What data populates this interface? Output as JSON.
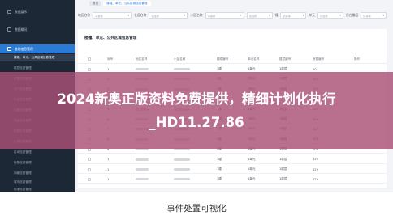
{
  "tabs": [
    {
      "label": "首页",
      "active": false
    },
    {
      "label": "楼幢、单元、公共区域信息管理",
      "active": true
    }
  ],
  "sidebar": {
    "items": [
      {
        "label": "数据展示",
        "active": false
      },
      {
        "label": "数据概况",
        "active": false
      },
      {
        "label": "基础信息管理",
        "active": true
      }
    ],
    "subitems": [
      {
        "label": "楼幢、单元、公共区域信息管理",
        "active": true
      },
      {
        "label": "楼层信息管理",
        "active": false
      },
      {
        "label": "房屋信息管理",
        "active": false
      },
      {
        "label": "住户信息管理",
        "active": false
      },
      {
        "label": "车位信息管理",
        "active": false
      },
      {
        "label": "设备信息管理",
        "active": false
      },
      {
        "label": "商铺信息管理",
        "active": false
      },
      {
        "label": "物业信息管理",
        "active": false
      },
      {
        "label": "小区信息管理",
        "active": false
      },
      {
        "label": "区域信息管理",
        "active": false
      },
      {
        "label": "标签信息管理",
        "active": false
      },
      {
        "label": "网格信息管理",
        "active": false
      },
      {
        "label": "城市信息管理",
        "active": false
      },
      {
        "label": "街道信息管理",
        "active": false
      }
    ]
  },
  "filters": [
    {
      "label": "地区名称",
      "placeholder": "请选择"
    },
    {
      "label": "社区名称",
      "placeholder": "请选择"
    },
    {
      "label": "小区名称",
      "placeholder": "请选择"
    },
    {
      "label": "幢",
      "placeholder": "请选择"
    },
    {
      "label": "单元",
      "placeholder": "请选择"
    },
    {
      "label": "所在楼层",
      "placeholder": "请选择"
    }
  ],
  "panel": {
    "title": "楼幢、单元、公共区域信息管理"
  },
  "table": {
    "headers": [
      "",
      "序号",
      "地区名称",
      "小区名称",
      "楼幢编号",
      "单元名称",
      "楼层编号",
      "房屋编号",
      "操作"
    ],
    "rows": [
      {
        "index": "1",
        "building": "1幢",
        "unit": "1单元",
        "floor": "1楼层",
        "room": "101"
      },
      {
        "index": "2",
        "building": "1幢",
        "unit": "1单元",
        "floor": "1楼层",
        "room": "102"
      },
      {
        "index": "3",
        "building": "1幢",
        "unit": "1单元",
        "floor": "1楼层",
        "room": "103"
      },
      {
        "index": "4",
        "building": "1幢",
        "unit": "1单元",
        "floor": "1楼层",
        "room": "104"
      },
      {
        "index": "5",
        "building": "1幢",
        "unit": "1单元",
        "floor": "1楼层",
        "room": "105"
      },
      {
        "index": "6",
        "building": "1幢",
        "unit": "1单元",
        "floor": "1楼层",
        "room": "106"
      },
      {
        "index": "7",
        "building": "1幢",
        "unit": "1单元",
        "floor": "1楼层",
        "room": "107"
      },
      {
        "index": "8",
        "building": "1幢",
        "unit": "1单元",
        "floor": "1楼层",
        "room": "108"
      },
      {
        "index": "9",
        "building": "1幢",
        "unit": "1单元",
        "floor": "1楼层",
        "room": "109"
      },
      {
        "index": "1",
        "building": "1幢",
        "unit": "1单元",
        "floor": "1楼层",
        "room": "120"
      },
      {
        "index": "1",
        "building": "1幢",
        "unit": "1单元",
        "floor": "1楼层",
        "room": "129"
      },
      {
        "index": "1",
        "building": "1幢",
        "unit": "1单元",
        "floor": "1楼层",
        "room": "129"
      }
    ]
  },
  "banner": {
    "text": "2024新奥正版资料免费提供，精细计划化执行_HD11.27.86"
  },
  "caption": {
    "text": "事件处置可视化"
  },
  "colors": {
    "sidebar_bg": "#1c2836",
    "accent": "#2a7bd6",
    "banner_overlay": "#aa5076"
  },
  "icons": {
    "sidebar": "square-icon",
    "select_caret": "chevron-down-icon"
  }
}
